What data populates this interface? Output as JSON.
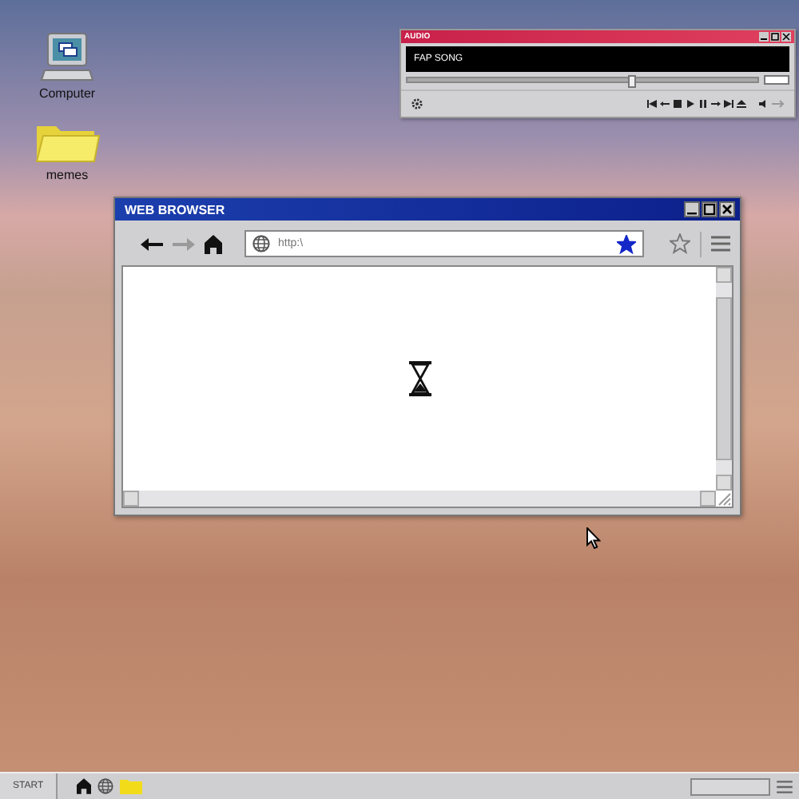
{
  "desktop_icons": [
    {
      "label": "Computer",
      "kind": "computer"
    },
    {
      "label": "memes",
      "kind": "folder"
    }
  ],
  "audio_player": {
    "title": "AUDIO",
    "track": "FAP SONG",
    "seek": {
      "level": 0.63
    }
  },
  "browser": {
    "title": "WEB BROWSER",
    "back": {
      "disabled": false
    },
    "forward": {
      "disabled": true
    },
    "address": {
      "placeholder": "http:\\"
    },
    "bookmarked": true,
    "loading": true
  },
  "taskbar": {
    "start": "START"
  }
}
